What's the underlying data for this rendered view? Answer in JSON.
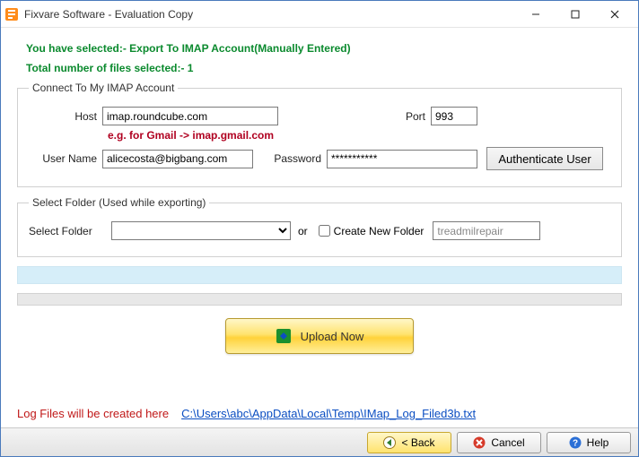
{
  "window": {
    "title": "Fixvare Software - Evaluation Copy"
  },
  "info": {
    "selected_line": "You have selected:- Export To IMAP Account(Manually Entered)",
    "count_line": "Total number of files selected:- 1"
  },
  "imap_group": {
    "legend": "Connect To My IMAP Account",
    "host_label": "Host",
    "host_value": "imap.roundcube.com",
    "port_label": "Port",
    "port_value": "993",
    "hint": "e.g. for Gmail -> imap.gmail.com",
    "user_label": "User Name",
    "user_value": "alicecosta@bigbang.com",
    "pass_label": "Password",
    "pass_value": "***********",
    "auth_button": "Authenticate User"
  },
  "folder_group": {
    "legend": "Select Folder (Used while exporting)",
    "select_label": "Select Folder",
    "or_label": "or",
    "create_label": "Create New Folder",
    "newfolder_value": "treadmilrepair"
  },
  "upload": {
    "label": "Upload Now"
  },
  "log": {
    "prefix": "Log Files will be created here",
    "path": "C:\\Users\\abc\\AppData\\Local\\Temp\\IMap_Log_Filed3b.txt"
  },
  "footer": {
    "back": "< Back",
    "cancel": "Cancel",
    "help": "Help"
  }
}
